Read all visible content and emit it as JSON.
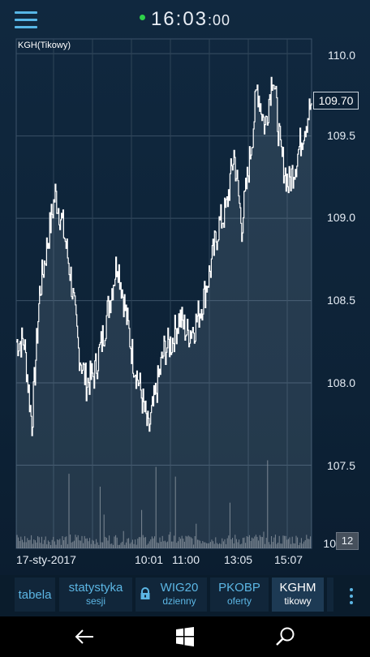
{
  "header": {
    "time_main": "16:03",
    "time_seconds": ":00",
    "status_color": "#2ed24a"
  },
  "chart": {
    "title": "KGH(Tikowy)",
    "last_price": "109.70",
    "volume_badge": "12",
    "y_ticks": [
      "110.0",
      "109.5",
      "109.0",
      "108.5",
      "108.0",
      "107.5",
      "10"
    ],
    "x_ticks": [
      "17-sty-2017",
      "10:01",
      "11:00",
      "13:05",
      "15:07"
    ]
  },
  "chart_data": {
    "type": "line",
    "title": "KGH(Tikowy)",
    "x": [
      "09:00",
      "09:05",
      "09:10",
      "09:20",
      "09:30",
      "09:40",
      "09:50",
      "10:00",
      "10:01",
      "10:10",
      "10:20",
      "10:30",
      "10:40",
      "10:50",
      "11:00",
      "11:10",
      "11:20",
      "11:30",
      "11:40",
      "11:50",
      "12:00",
      "12:15",
      "12:30",
      "12:45",
      "13:00",
      "13:05",
      "13:15",
      "13:30",
      "13:45",
      "14:00",
      "14:15",
      "14:30",
      "14:45",
      "15:00",
      "15:07",
      "15:20",
      "15:30",
      "15:45",
      "16:00"
    ],
    "values": [
      108.25,
      108.25,
      107.75,
      108.55,
      108.85,
      109.15,
      108.95,
      108.65,
      108.2,
      108.0,
      108.05,
      108.25,
      108.5,
      108.75,
      108.45,
      108.15,
      107.95,
      107.7,
      107.95,
      108.2,
      108.25,
      108.4,
      108.3,
      108.35,
      108.5,
      108.7,
      108.95,
      109.05,
      109.4,
      108.95,
      109.35,
      109.8,
      109.55,
      109.9,
      109.4,
      109.2,
      109.35,
      109.55,
      109.7
    ],
    "ylim": [
      107.0,
      110.05
    ],
    "series_color": "#ffffff",
    "volume_color": "#8c96a0",
    "grid": true
  },
  "tabs": [
    {
      "label": "tabela",
      "sub": ""
    },
    {
      "label": "statystyka",
      "sub": "sesji"
    },
    {
      "label": "WIG20",
      "sub": "dzienny"
    },
    {
      "label": "PKOBP",
      "sub": "oferty"
    },
    {
      "label": "KGHM",
      "sub": "tikowy"
    }
  ],
  "icons": {
    "menu": "hamburger-icon",
    "lock": "lock-icon",
    "more": "more-icon",
    "back": "back-arrow-icon",
    "windows": "windows-icon",
    "search": "search-icon"
  }
}
